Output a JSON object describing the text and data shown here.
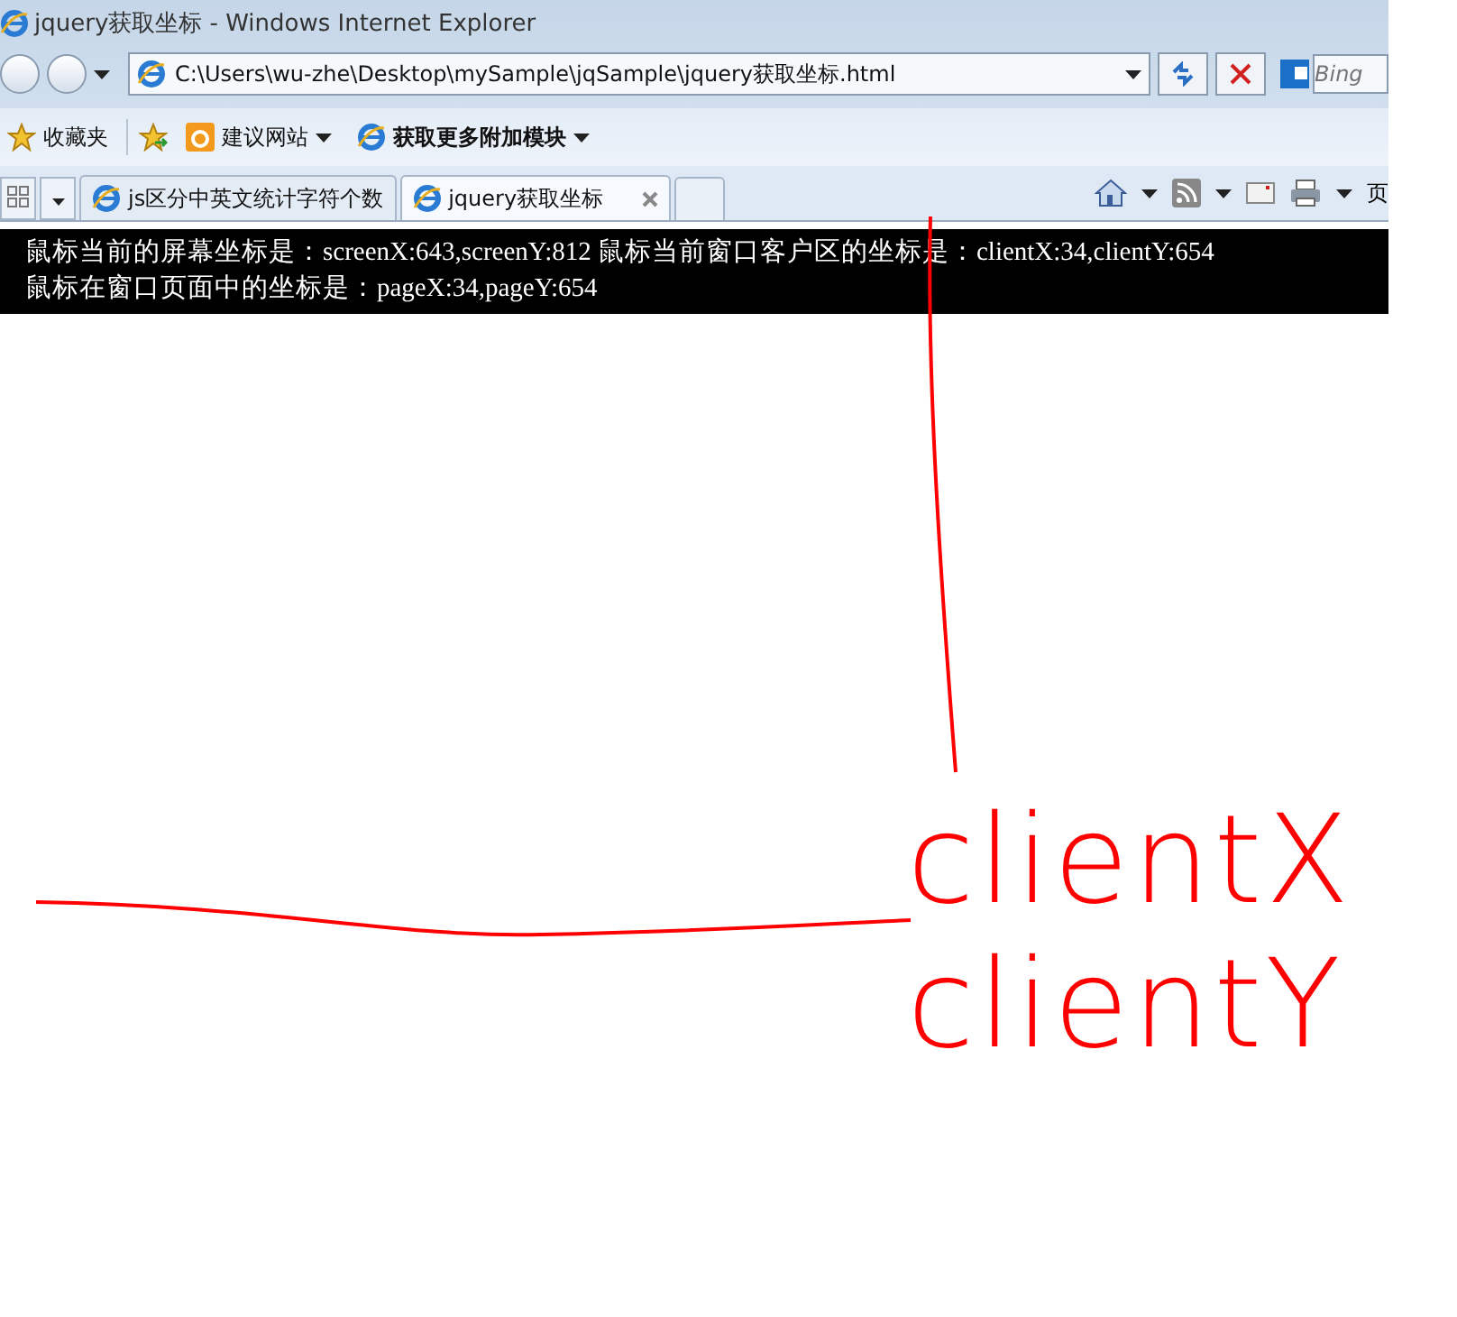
{
  "window": {
    "title": "jquery获取坐标 - Windows Internet Explorer"
  },
  "address_bar": {
    "value": "C:\\Users\\wu-zhe\\Desktop\\mySample\\jqSample\\jquery获取坐标.html"
  },
  "search": {
    "placeholder": "Bing"
  },
  "favorites_bar": [
    {
      "kind": "star",
      "label": "收藏夹"
    },
    {
      "kind": "site",
      "label": "建议网站"
    },
    {
      "kind": "addon",
      "label": "获取更多附加模块"
    }
  ],
  "tabs": [
    {
      "label": "js区分中英文统计字符个数",
      "selected": false
    },
    {
      "label": "jquery获取坐标",
      "selected": true
    }
  ],
  "command_bar": {
    "page_menu": "页"
  },
  "page": {
    "lines": [
      "鼠标当前的屏幕坐标是：screenX:643,screenY:812 鼠标当前窗口客户区的坐标是：clientX:34,clientY:654",
      "鼠标在窗口页面中的坐标是：pageX:34,pageY:654"
    ]
  },
  "annotations": [
    {
      "kind": "vertical-line"
    },
    {
      "kind": "horizontal-line"
    },
    {
      "kind": "text",
      "text": "clientX"
    },
    {
      "kind": "text",
      "text": "clientY"
    }
  ]
}
